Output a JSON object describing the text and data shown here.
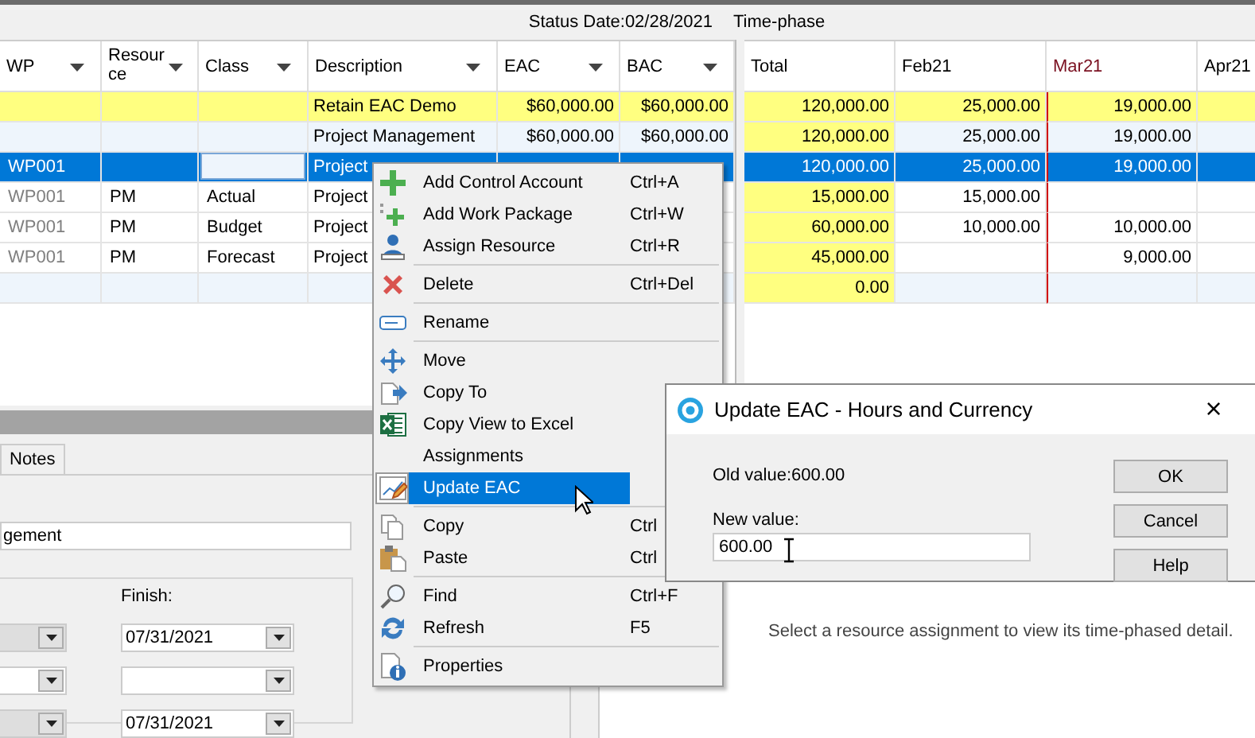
{
  "header": {
    "status_date": "Status Date:02/28/2021",
    "time_phase": "Time-phase"
  },
  "grid": {
    "columns": [
      {
        "label": "WP",
        "filter": true
      },
      {
        "label": "Resource",
        "filter": true
      },
      {
        "label": "Class",
        "filter": true
      },
      {
        "label": "Description",
        "filter": true
      },
      {
        "label": "EAC",
        "filter": true
      },
      {
        "label": "BAC",
        "filter": true
      }
    ]
  },
  "timephase": {
    "columns": [
      {
        "label": "Total",
        "highlighted": true,
        "current": false
      },
      {
        "label": "Feb21",
        "highlighted": false,
        "current": false
      },
      {
        "label": "Mar21",
        "highlighted": false,
        "current": true
      },
      {
        "label": "Apr21",
        "highlighted": false,
        "current": false
      }
    ]
  },
  "rows": [
    {
      "kind": "project",
      "selected": false,
      "editing": false,
      "description": "Retain EAC Demo",
      "eac": "$60,000.00",
      "bac": "$60,000.00",
      "total": "120,000.00",
      "feb21": "25,000.00",
      "mar21": "19,000.00"
    },
    {
      "kind": "account",
      "selected": false,
      "editing": false,
      "description": "Project Management",
      "eac": "$60,000.00",
      "bac": "$60,000.00",
      "total": "120,000.00",
      "feb21": "25,000.00",
      "mar21": "19,000.00"
    },
    {
      "kind": "package",
      "selected": true,
      "editing": true,
      "wp": "WP001",
      "description": "Project",
      "total": "120,000.00",
      "feb21": "25,000.00",
      "mar21": "19,000.00"
    },
    {
      "kind": "assignment",
      "selected": false,
      "editing": false,
      "wp": "WP001",
      "resource": "PM",
      "class": "Actual",
      "description": "Project",
      "total": "15,000.00",
      "feb21": "15,000.00"
    },
    {
      "kind": "assignment",
      "selected": false,
      "editing": false,
      "wp": "WP001",
      "resource": "PM",
      "class": "Budget",
      "description": "Project",
      "total": "60,000.00",
      "feb21": "10,000.00",
      "mar21": "10,000.00"
    },
    {
      "kind": "assignment",
      "selected": false,
      "editing": false,
      "wp": "WP001",
      "resource": "PM",
      "class": "Forecast",
      "description": "Project",
      "total": "45,000.00",
      "mar21": "9,000.00"
    },
    {
      "kind": "blank",
      "selected": false,
      "editing": false,
      "total": "0.00"
    }
  ],
  "detail_panel": {
    "tabs": [
      {
        "label": "Notes",
        "selected": false
      }
    ],
    "name_value": "gement",
    "finish_label": "Finish:",
    "dates": [
      {
        "start_disabled": true,
        "finish": "07/31/2021"
      },
      {
        "start_disabled": false
      },
      {
        "start_disabled": true,
        "finish": "07/31/2021"
      }
    ]
  },
  "timephase_detail": {
    "message": "Select a resource assignment to view its time-phased detail."
  },
  "context_menu": {
    "items": [
      {
        "kind": "command",
        "label": "Add Control Account",
        "shortcut": "Ctrl+A",
        "selected": false
      },
      {
        "kind": "command",
        "label": "Add Work Package",
        "shortcut": "Ctrl+W",
        "selected": false
      },
      {
        "kind": "command",
        "label": "Assign Resource",
        "shortcut": "Ctrl+R",
        "selected": false
      },
      {
        "kind": "separator"
      },
      {
        "kind": "command",
        "label": "Delete",
        "shortcut": "Ctrl+Del",
        "selected": false
      },
      {
        "kind": "separator"
      },
      {
        "kind": "command",
        "label": "Rename",
        "selected": false
      },
      {
        "kind": "separator"
      },
      {
        "kind": "command",
        "label": "Move",
        "selected": false
      },
      {
        "kind": "command",
        "label": "Copy To",
        "selected": false
      },
      {
        "kind": "command",
        "label": "Copy View to Excel",
        "selected": false
      },
      {
        "kind": "command",
        "label": "Assignments",
        "selected": false
      },
      {
        "kind": "command",
        "label": "Update EAC",
        "selected": true
      },
      {
        "kind": "separator"
      },
      {
        "kind": "command",
        "label": "Copy",
        "shortcut": "Ctrl",
        "selected": false
      },
      {
        "kind": "command",
        "label": "Paste",
        "shortcut": "Ctrl",
        "selected": false
      },
      {
        "kind": "separator"
      },
      {
        "kind": "command",
        "label": "Find",
        "shortcut": "Ctrl+F",
        "selected": false
      },
      {
        "kind": "command",
        "label": "Refresh",
        "shortcut": "F5",
        "selected": false
      },
      {
        "kind": "separator"
      },
      {
        "kind": "command",
        "label": "Properties",
        "selected": false
      }
    ]
  },
  "dialog": {
    "title": "Update EAC - Hours and Currency",
    "close": "×",
    "old_value": "Old value:600.00",
    "new_value_label": "New value:",
    "new_value": "600.00",
    "buttons": [
      "OK",
      "Cancel",
      "Help"
    ]
  }
}
